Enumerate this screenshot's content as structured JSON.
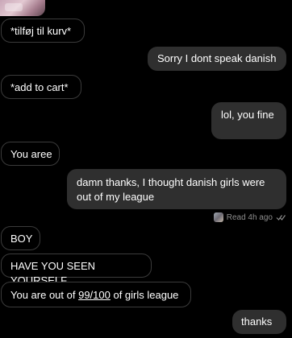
{
  "messages": [
    {
      "side": "in",
      "text": "*tilføj til kurv*"
    },
    {
      "side": "out",
      "text": "Sorry I dont speak danish"
    },
    {
      "side": "in",
      "text": "*add to cart*"
    },
    {
      "side": "out",
      "text": "lol, you fine"
    },
    {
      "side": "in",
      "text": "You aree"
    },
    {
      "side": "out",
      "text": "damn thanks, I thought danish girls were out of my league"
    },
    {
      "side": "in",
      "text": "BOY"
    },
    {
      "side": "in",
      "text": "HAVE YOU SEEN YOURSELF"
    },
    {
      "side": "in",
      "text_before": "You are out of ",
      "text_link": "99/100",
      "text_after": " of girls league"
    },
    {
      "side": "out",
      "text": "thanks"
    }
  ],
  "receipt": {
    "label": "Read 4h ago",
    "icon": "double-check-icon"
  },
  "colors": {
    "background": "#000000",
    "incoming_border": "#3b3b3b",
    "outgoing_bubble": "#2f2f2f",
    "receipt_text": "#8d8d8d"
  }
}
